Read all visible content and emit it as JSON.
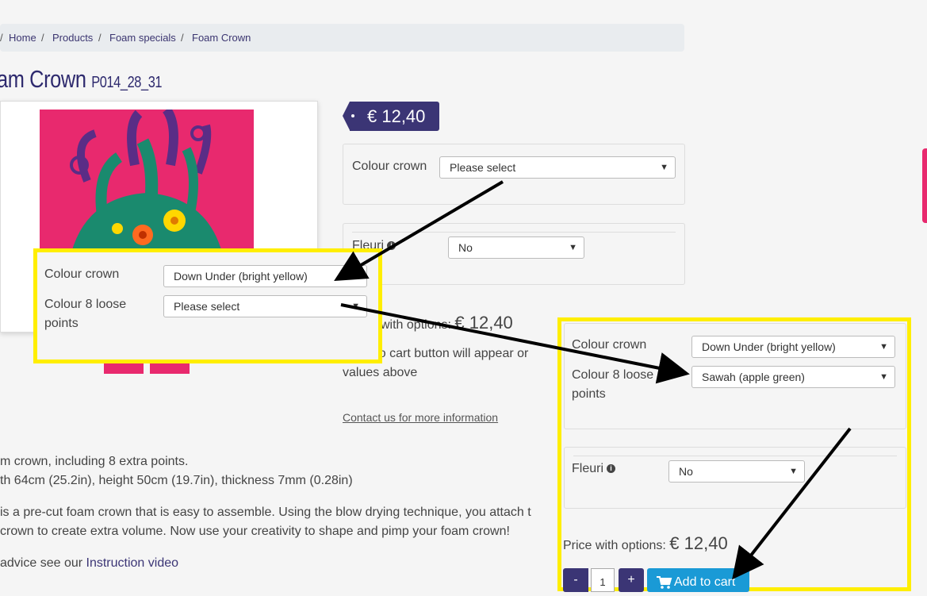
{
  "breadcrumb": {
    "items": [
      "Home",
      "Products",
      "Foam specials",
      "Foam Crown"
    ],
    "separator": "/"
  },
  "product": {
    "title_part": "am Crown",
    "sku": "P014_28_31",
    "price": "€ 12,40"
  },
  "options_form": {
    "colour_crown_label": "Colour crown",
    "colour_crown_value": "Please select",
    "fleuri_label": "Fleuri",
    "fleuri_value": "No",
    "price_with_options_fragment": "with options:",
    "price_with_options_value": "€ 12,40",
    "cart_notice_line1": "d to cart button will appear or",
    "cart_notice_line2": "values above",
    "contact_link": "Contact us for more information"
  },
  "callout_left": {
    "colour_crown_label": "Colour crown",
    "colour_crown_value": "Down Under (bright yellow)",
    "loose_points_label_line1": "Colour 8 loose",
    "loose_points_label_line2": "points",
    "loose_points_value": "Please select"
  },
  "callout_right": {
    "colour_crown_label": "Colour crown",
    "colour_crown_value": "Down Under (bright yellow)",
    "loose_points_label_line1": "Colour 8 loose",
    "loose_points_label_line2": "points",
    "loose_points_value": "Sawah (apple green)",
    "fleuri_label": "Fleuri",
    "fleuri_value": "No",
    "price_label": "Price with options:",
    "price_value": "€ 12,40",
    "qty_minus": "-",
    "qty_value": "1",
    "qty_plus": "+",
    "add_to_cart": "Add to cart"
  },
  "description": {
    "line1": "m crown, including 8 extra points.",
    "line2": "th 64cm (25.2in), height 50cm (19.7in), thickness 7mm (0.28in)",
    "line3": " is a pre-cut foam crown that is easy to assemble. Using the blow drying technique, you attach t",
    "line4": "crown to create extra volume. Now use your creativity to shape and pimp your foam crown!",
    "line5_prefix": "advice see our ",
    "line5_link": "Instruction video"
  },
  "icons": {
    "info": "info-icon",
    "cart": "cart-icon",
    "chevron": "chevron-down-icon"
  },
  "colors": {
    "brand": "#3b3575",
    "highlight": "#ffee00",
    "cart_button": "#1a9ad6"
  }
}
